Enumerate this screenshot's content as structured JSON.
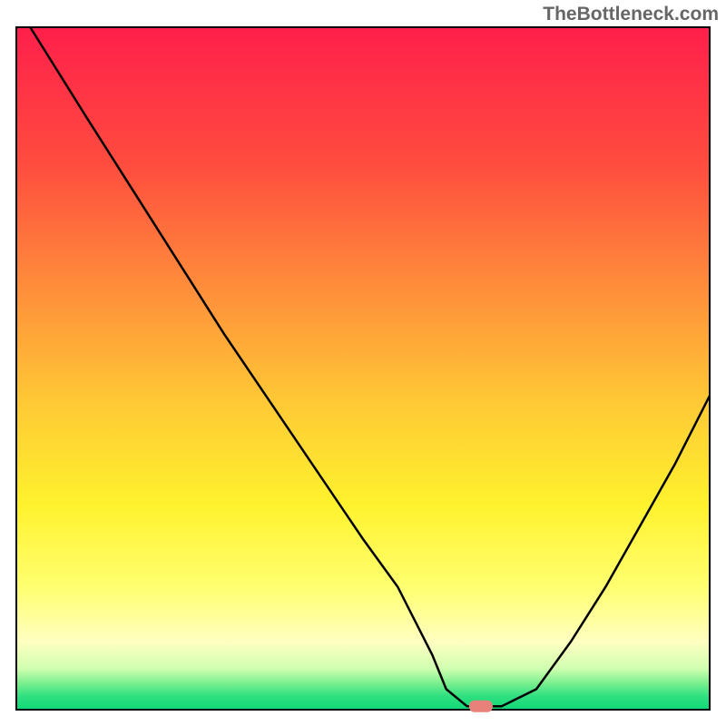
{
  "watermark": "TheBottleneck.com",
  "chart_data": {
    "type": "line",
    "title": "",
    "xlabel": "",
    "ylabel": "",
    "xlim": [
      0,
      100
    ],
    "ylim": [
      0,
      100
    ],
    "series": [
      {
        "name": "curve",
        "x": [
          2,
          10,
          20,
          25,
          30,
          40,
          50,
          55,
          60,
          62,
          65,
          70,
          75,
          80,
          85,
          90,
          95,
          100
        ],
        "y": [
          100,
          87,
          71,
          63,
          55,
          40,
          25,
          18,
          8,
          3,
          0.5,
          0.5,
          3,
          10,
          18,
          27,
          36,
          46
        ]
      }
    ],
    "marker": {
      "x": 67,
      "y": 0.5,
      "color": "#e8817a"
    },
    "gradient_stops": [
      {
        "offset": 0,
        "color": "#ff1f4b"
      },
      {
        "offset": 20,
        "color": "#ff4c3f"
      },
      {
        "offset": 40,
        "color": "#ff943a"
      },
      {
        "offset": 55,
        "color": "#ffc935"
      },
      {
        "offset": 70,
        "color": "#fff22d"
      },
      {
        "offset": 82,
        "color": "#ffff70"
      },
      {
        "offset": 90,
        "color": "#ffffc0"
      },
      {
        "offset": 94,
        "color": "#d0ffb0"
      },
      {
        "offset": 96,
        "color": "#80f090"
      },
      {
        "offset": 98,
        "color": "#30e080"
      },
      {
        "offset": 100,
        "color": "#10d878"
      }
    ]
  }
}
